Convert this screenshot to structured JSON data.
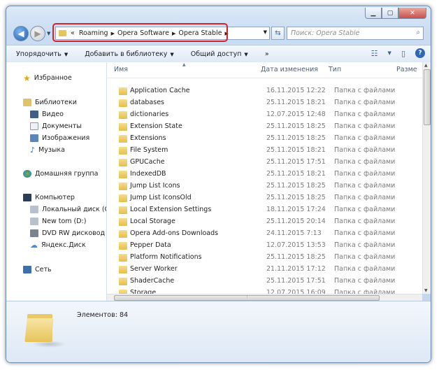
{
  "window": {
    "controls": {
      "minimize": "▁",
      "maximize": "▢",
      "close": "✕"
    }
  },
  "address": {
    "overflow": "«",
    "crumbs": [
      "Roaming",
      "Opera Software",
      "Opera Stable"
    ],
    "search_placeholder": "Поиск: Opera Stable"
  },
  "toolbar": {
    "organize": "Упорядочить",
    "add_library": "Добавить в библиотеку",
    "share": "Общий доступ",
    "more": "»"
  },
  "sidebar": {
    "favorites": "Избранное",
    "libraries": "Библиотеки",
    "lib_items": [
      "Видео",
      "Документы",
      "Изображения",
      "Музыка"
    ],
    "homegroup": "Домашняя группа",
    "computer": "Компьютер",
    "drives": [
      "Локальный диск (C",
      "New tom (D:)",
      "DVD RW дисковод (",
      "Яндекс.Диск"
    ],
    "network": "Сеть"
  },
  "columns": {
    "name": "Имя",
    "date": "Дата изменения",
    "type": "Тип",
    "size": "Разме"
  },
  "files": [
    {
      "name": "Application Cache",
      "date": "16.11.2015 12:22",
      "type": "Папка с файлами"
    },
    {
      "name": "databases",
      "date": "25.11.2015 18:21",
      "type": "Папка с файлами"
    },
    {
      "name": "dictionaries",
      "date": "12.07.2015 12:48",
      "type": "Папка с файлами"
    },
    {
      "name": "Extension State",
      "date": "25.11.2015 18:25",
      "type": "Папка с файлами"
    },
    {
      "name": "Extensions",
      "date": "25.11.2015 18:25",
      "type": "Папка с файлами"
    },
    {
      "name": "File System",
      "date": "25.11.2015 18:21",
      "type": "Папка с файлами"
    },
    {
      "name": "GPUCache",
      "date": "25.11.2015 17:51",
      "type": "Папка с файлами"
    },
    {
      "name": "IndexedDB",
      "date": "25.11.2015 18:21",
      "type": "Папка с файлами"
    },
    {
      "name": "Jump List Icons",
      "date": "25.11.2015 18:25",
      "type": "Папка с файлами"
    },
    {
      "name": "Jump List IconsOld",
      "date": "25.11.2015 18:25",
      "type": "Папка с файлами"
    },
    {
      "name": "Local Extension Settings",
      "date": "18.11.2015 17:24",
      "type": "Папка с файлами"
    },
    {
      "name": "Local Storage",
      "date": "25.11.2015 20:14",
      "type": "Папка с файлами"
    },
    {
      "name": "Opera Add-ons Downloads",
      "date": "24.11.2015 7:13",
      "type": "Папка с файлами"
    },
    {
      "name": "Pepper Data",
      "date": "12.07.2015 13:53",
      "type": "Папка с файлами"
    },
    {
      "name": "Platform Notifications",
      "date": "25.11.2015 18:25",
      "type": "Папка с файлами"
    },
    {
      "name": "Server Worker",
      "date": "21.11.2015 17:12",
      "type": "Папка с файлами"
    },
    {
      "name": "ShaderCache",
      "date": "25.11.2015 17:51",
      "type": "Папка с файлами"
    },
    {
      "name": "Storage",
      "date": "12.07.2015 16:09",
      "type": "Папка с файлами"
    }
  ],
  "details": {
    "count_label": "Элементов: 84"
  },
  "icons": {
    "back": "back-arrow-icon",
    "forward": "forward-arrow-icon",
    "refresh": "refresh-icon",
    "search": "search-icon",
    "views": "views-icon",
    "preview": "preview-pane-icon",
    "help": "help-icon"
  }
}
